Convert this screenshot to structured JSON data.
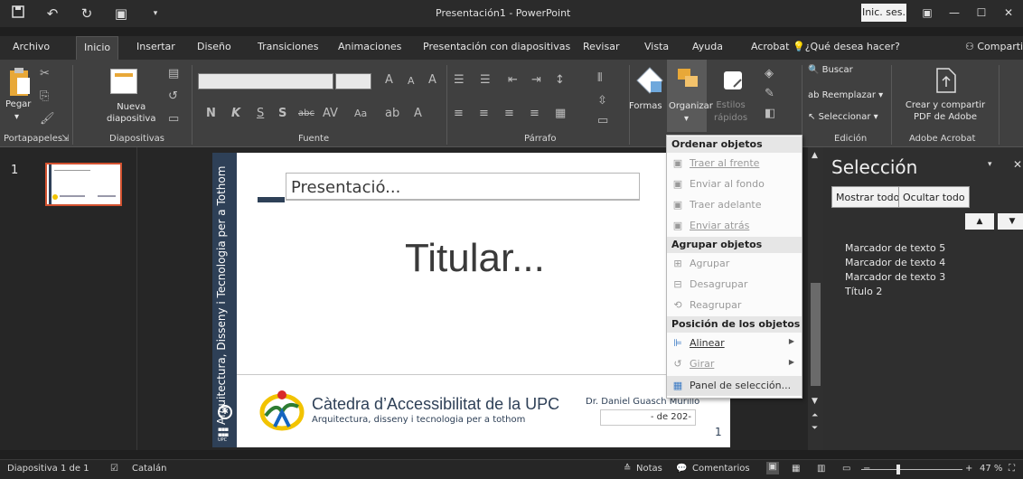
{
  "window": {
    "title": "Presentación1 - PowerPoint",
    "signin": "Inic. ses."
  },
  "qat": {
    "save_icon": "save-icon",
    "undo_icon": "undo-icon",
    "redo_icon": "redo-icon",
    "start_icon": "start-from-beginning-icon"
  },
  "tabs": [
    "Archivo",
    "Inicio",
    "Insertar",
    "Diseño",
    "Transiciones",
    "Animaciones",
    "Presentación con diapositivas",
    "Revisar",
    "Vista",
    "Ayuda",
    "Acrobat"
  ],
  "tellme": "¿Qué desea hacer?",
  "share": "Compartir",
  "ribbon": {
    "portapapeles": {
      "label": "Portapapeles",
      "paste": "Pegar"
    },
    "diapositivas": {
      "label": "Diapositivas",
      "new_slide_1": "Nueva",
      "new_slide_2": "diapositiva"
    },
    "fuente": {
      "label": "Fuente",
      "bold": "N",
      "italic": "K",
      "underline": "S",
      "shadow": "S",
      "strike": "abc",
      "spacing": "AV",
      "case": "Aa"
    },
    "parrafo": {
      "label": "Párrafo"
    },
    "dibujo": {
      "shapes": "Formas",
      "arrange": "Organizar",
      "styles_1": "Estilos",
      "styles_2": "rápidos"
    },
    "edicion": {
      "label": "Edición",
      "find": "Buscar",
      "replace": "Reemplazar",
      "select": "Seleccionar"
    },
    "acrobat": {
      "label": "Adobe Acrobat",
      "create_1": "Crear y compartir",
      "create_2": "PDF de Adobe"
    }
  },
  "thumbnails": {
    "slide_number": "1"
  },
  "slide": {
    "vertical_text": "Arquitectura, Disseny i Tecnologia per a Tothom",
    "placeholder_title": "Presentació...",
    "main_title": "Titular...",
    "catedra_name": "Càtedra d’Accessibilitat de la UPC",
    "catedra_sub": "Arquitectura, disseny i tecnologia per a tothom",
    "author": "Dr. Daniel Guasch Murillo",
    "date": "- de 202-",
    "page": "1",
    "upc_logo": "UPC"
  },
  "arrange_menu": {
    "sections": [
      {
        "header": "Ordenar objetos",
        "items": [
          {
            "label": "Traer al frente",
            "icon": "bring-to-front-icon",
            "enabled": false
          },
          {
            "label": "Enviar al fondo",
            "icon": "send-to-back-icon",
            "enabled": false
          },
          {
            "label": "Traer adelante",
            "icon": "bring-forward-icon",
            "enabled": false
          },
          {
            "label": "Enviar atrás",
            "icon": "send-backward-icon",
            "enabled": false
          }
        ]
      },
      {
        "header": "Agrupar objetos",
        "items": [
          {
            "label": "Agrupar",
            "icon": "group-icon",
            "enabled": false
          },
          {
            "label": "Desagrupar",
            "icon": "ungroup-icon",
            "enabled": false
          },
          {
            "label": "Reagrupar",
            "icon": "regroup-icon",
            "enabled": false
          }
        ]
      },
      {
        "header": "Posición de los objetos",
        "items": [
          {
            "label": "Alinear",
            "icon": "align-icon",
            "enabled": true,
            "submenu": true
          },
          {
            "label": "Girar",
            "icon": "rotate-icon",
            "enabled": false,
            "submenu": true
          },
          {
            "label": "Panel de selección...",
            "icon": "selection-pane-icon",
            "enabled": true,
            "hover": true
          }
        ]
      }
    ]
  },
  "selection_pane": {
    "title": "Selección",
    "show_all": "Mostrar todo",
    "hide_all": "Ocultar todo",
    "items": [
      "Marcador de texto 5",
      "Marcador de texto 4",
      "Marcador de texto 3",
      "Título 2"
    ]
  },
  "statusbar": {
    "slide_info": "Diapositiva 1 de 1",
    "language": "Catalán",
    "notes": "Notas",
    "comments": "Comentarios",
    "zoom": "47 %"
  },
  "colors": {
    "accent": "#d35230",
    "band": "#2e4057",
    "menu_bg": "#fbfbfb"
  }
}
